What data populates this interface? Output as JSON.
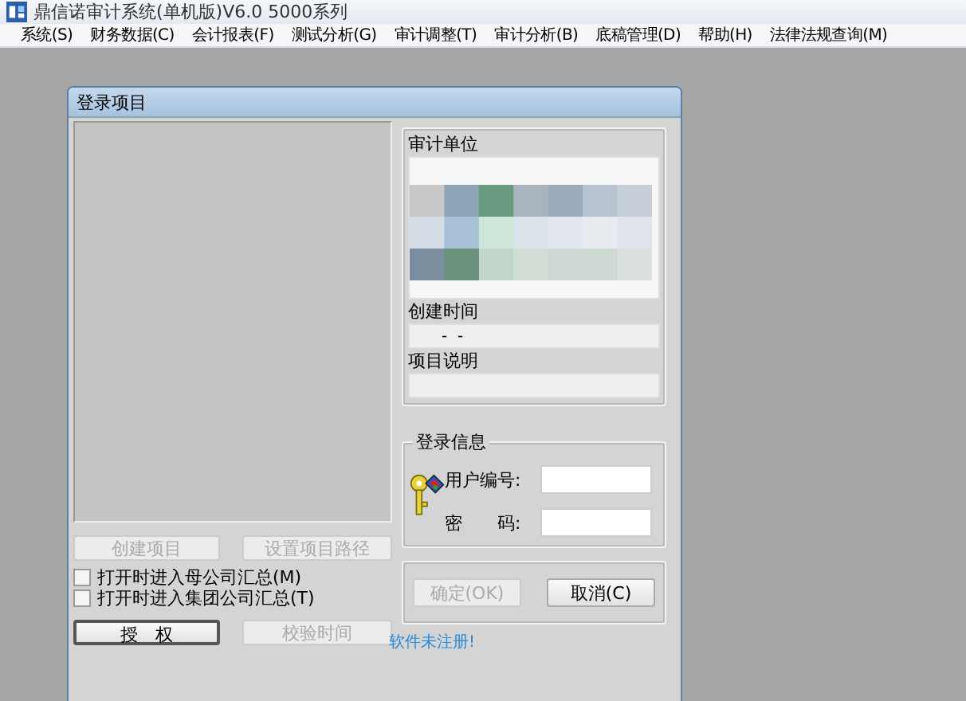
{
  "window": {
    "title": "鼎信诺审计系统(单机版)V6.0 5000系列"
  },
  "menu": [
    {
      "label": "系统(S)"
    },
    {
      "label": "财务数据(C)"
    },
    {
      "label": "会计报表(F)"
    },
    {
      "label": "测试分析(G)"
    },
    {
      "label": "审计调整(T)"
    },
    {
      "label": "审计分析(B)"
    },
    {
      "label": "底稿管理(D)"
    },
    {
      "label": "帮助(H)"
    },
    {
      "label": "法律法规查询(M)"
    }
  ],
  "dialog": {
    "title": "登录项目",
    "project_buttons": [
      {
        "label": "创建项目",
        "disabled": true
      },
      {
        "label": "设置项目路径",
        "disabled": true
      }
    ],
    "options": [
      {
        "label": "打开时进入母公司汇总(M)",
        "checked": false
      },
      {
        "label": "打开时进入集团公司汇总(T)",
        "checked": false
      }
    ],
    "bottom_buttons": [
      {
        "label": "授　权",
        "disabled": false
      },
      {
        "label": "校验时间",
        "disabled": true
      }
    ],
    "project_info": {
      "audit_unit": {
        "label": "审计单位"
      },
      "created_time": {
        "label": "创建时间",
        "value": "-  -"
      },
      "description": {
        "label": "项目说明"
      }
    },
    "login": {
      "title": "登录信息",
      "fields": [
        {
          "label": "用户编号:"
        },
        {
          "label": "密　　码:"
        }
      ]
    },
    "actions": [
      {
        "label": "确定(OK)",
        "disabled": true
      },
      {
        "label": "取消(C)",
        "disabled": false
      }
    ],
    "status_link": "软件未注册!"
  }
}
